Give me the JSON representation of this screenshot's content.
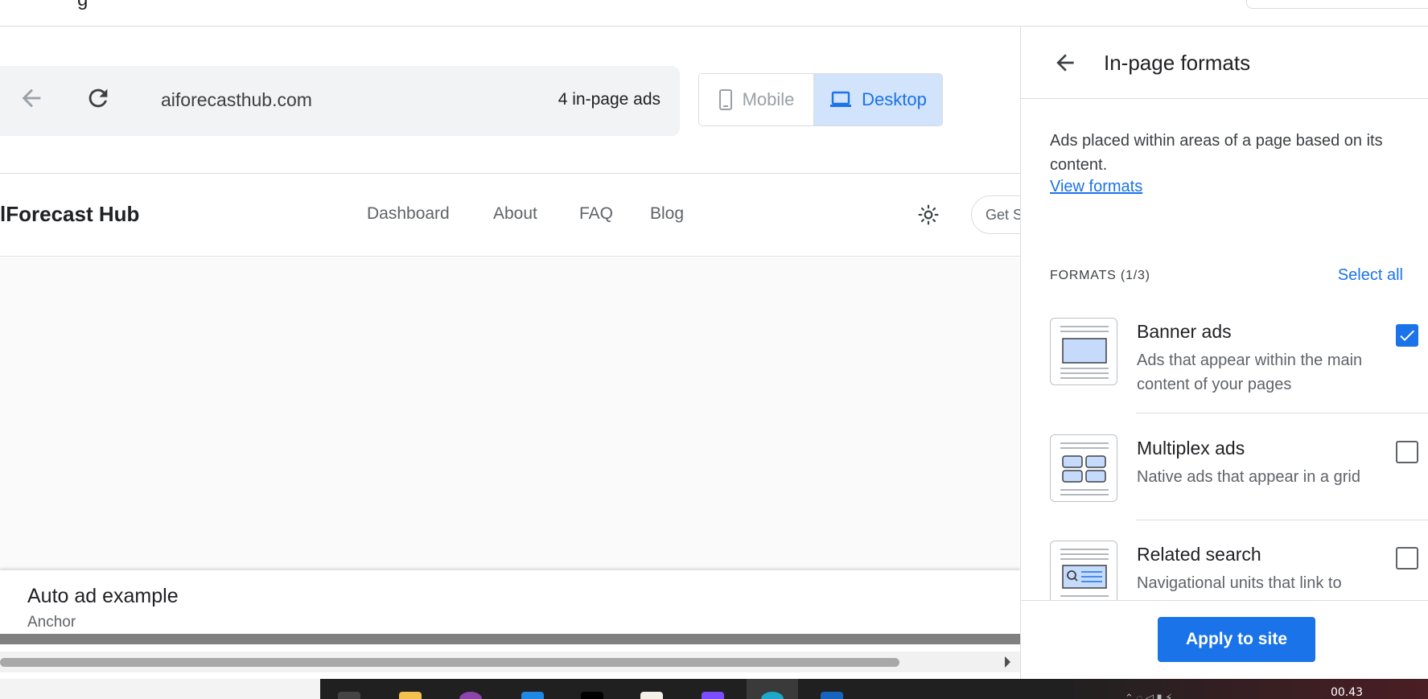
{
  "address_bar": {
    "url": "aiforecasthub.com",
    "ad_count": "4 in-page ads"
  },
  "device_toggle": {
    "mobile_label": "Mobile",
    "desktop_label": "Desktop",
    "selected": "Desktop"
  },
  "site": {
    "logo": "lForecast Hub",
    "nav": [
      "Dashboard",
      "About",
      "FAQ",
      "Blog"
    ],
    "cta_partial": "Get S"
  },
  "anchor_ad": {
    "title": "Auto ad example",
    "subtitle": "Anchor"
  },
  "panel": {
    "title": "In-page formats",
    "description": "Ads placed within areas of a page based on its content.",
    "link": "View formats",
    "formats_label": "FORMATS (1/3)",
    "select_all": "Select all",
    "formats": [
      {
        "title": "Banner ads",
        "desc": "Ads that appear within the main content of your pages",
        "checked": true
      },
      {
        "title": "Multiplex ads",
        "desc": "Native ads that appear in a grid",
        "checked": false
      },
      {
        "title": "Related search",
        "desc": "Navigational units that link to suggested search... with ad",
        "checked": false
      }
    ],
    "apply_button": "Apply to site"
  },
  "taskbar": {
    "clock": "00.43"
  },
  "colors": {
    "accent": "#1a73e8",
    "toggle_selected_bg": "#d2e3fc",
    "taskbar": "#202020"
  }
}
